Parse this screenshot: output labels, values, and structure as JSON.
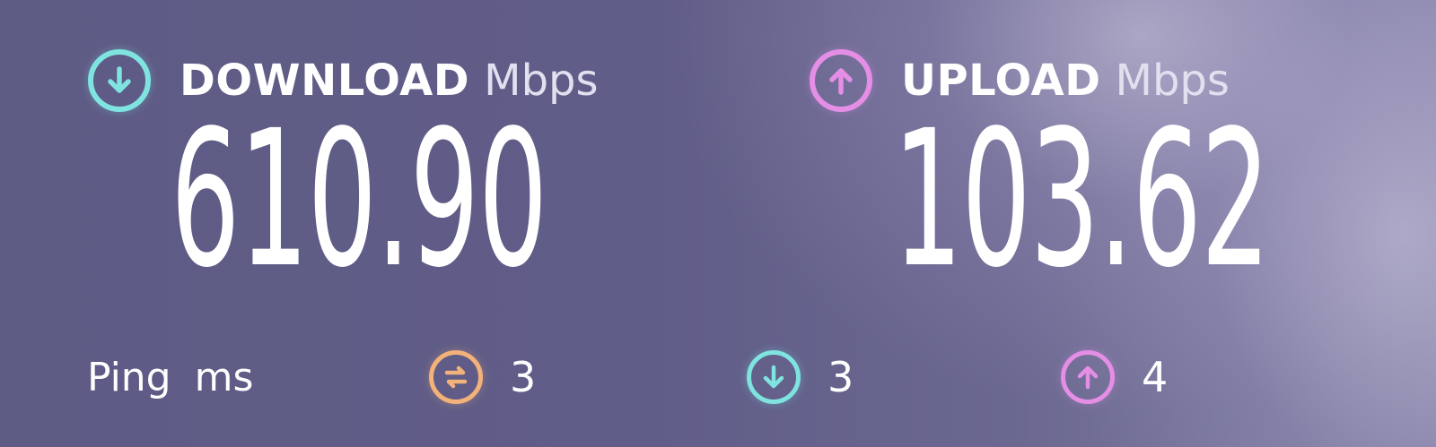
{
  "download": {
    "label": "DOWNLOAD",
    "unit": "Mbps",
    "value": "610.90",
    "icon": "arrow-down-circle-icon",
    "color": "#7fe3e0"
  },
  "upload": {
    "label": "UPLOAD",
    "unit": "Mbps",
    "value": "103.62",
    "icon": "arrow-up-circle-icon",
    "color": "#e48ee6"
  },
  "ping": {
    "label": "Ping",
    "unit": "ms",
    "idle": {
      "value": "3",
      "icon": "idle-latency-icon",
      "color": "#f2b27a"
    },
    "download": {
      "value": "3",
      "icon": "arrow-down-circle-icon",
      "color": "#7fe3e0"
    },
    "upload": {
      "value": "4",
      "icon": "arrow-up-circle-icon",
      "color": "#e48ee6"
    }
  }
}
